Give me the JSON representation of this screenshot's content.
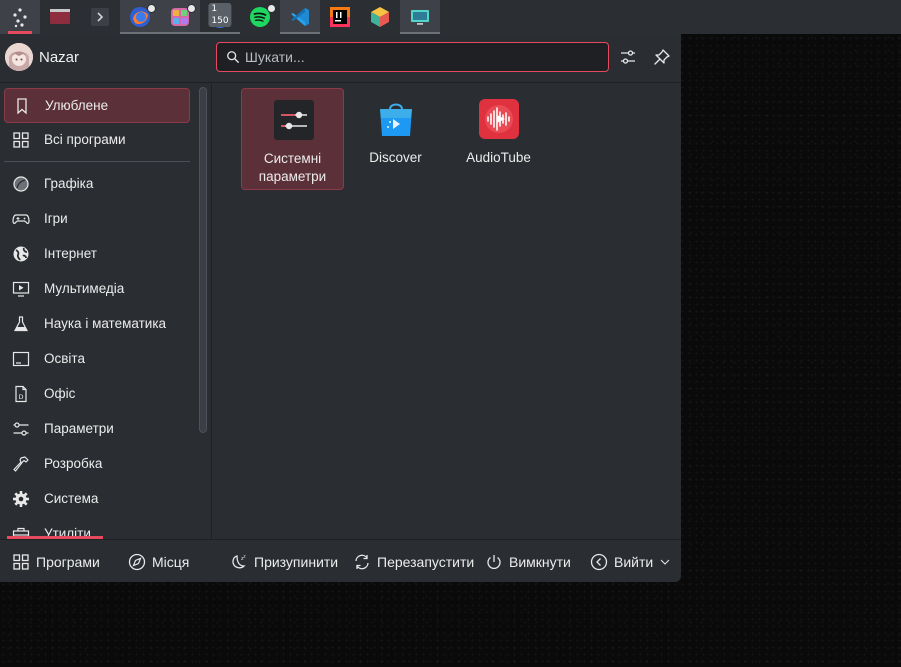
{
  "taskbar": {
    "items": [
      {
        "name": "application-launcher",
        "icon": "launcher-icon"
      },
      {
        "name": "window-manager",
        "icon": "window-icon"
      },
      {
        "name": "terminal",
        "icon": "terminal-icon"
      },
      {
        "name": "firefox",
        "icon": "firefox-icon"
      },
      {
        "name": "color-app",
        "icon": "palette-icon"
      },
      {
        "name": "mail",
        "icon": "mail-icon",
        "badge": "1 150"
      },
      {
        "name": "spotify",
        "icon": "spotify-icon"
      },
      {
        "name": "vscode",
        "icon": "vscode-icon"
      },
      {
        "name": "intellij",
        "icon": "intellij-icon"
      },
      {
        "name": "cube-app",
        "icon": "cube-icon"
      },
      {
        "name": "screen-app",
        "icon": "monitor-icon"
      }
    ],
    "mail_badge": "1 150",
    "accent": "#e54a5e"
  },
  "header": {
    "user_name": "Nazar",
    "search_placeholder": "Шукати...",
    "search_value": ""
  },
  "sidebar": {
    "items": [
      {
        "label": "Улюблене",
        "icon": "bookmark-icon",
        "selected": true
      },
      {
        "label": "Всі програми",
        "icon": "grid-icon"
      },
      {
        "label": "Графіка",
        "icon": "graphics-icon"
      },
      {
        "label": "Ігри",
        "icon": "gamepad-icon"
      },
      {
        "label": "Інтернет",
        "icon": "globe-icon"
      },
      {
        "label": "Мультимедіа",
        "icon": "multimedia-icon"
      },
      {
        "label": "Наука і математика",
        "icon": "flask-icon"
      },
      {
        "label": "Освіта",
        "icon": "education-icon"
      },
      {
        "label": "Офіс",
        "icon": "office-icon"
      },
      {
        "label": "Параметри",
        "icon": "settings-sliders-icon"
      },
      {
        "label": "Розробка",
        "icon": "hammer-icon"
      },
      {
        "label": "Система",
        "icon": "gear-icon"
      },
      {
        "label": "Утиліти",
        "icon": "toolbox-icon"
      }
    ]
  },
  "apps": [
    {
      "label": "Системні параметри",
      "icon": "system-settings-icon",
      "selected": true
    },
    {
      "label": "Discover",
      "icon": "discover-icon"
    },
    {
      "label": "AudioTube",
      "icon": "audiotube-icon"
    }
  ],
  "footer": {
    "programs": "Програми",
    "places": "Місця",
    "sleep": "Призупинити",
    "restart": "Перезапустити",
    "shutdown": "Вимкнути",
    "logout": "Вийти"
  },
  "colors": {
    "accent": "#e54a5e",
    "selection_bg": "#5c3039",
    "panel_bg": "#2a2d32"
  }
}
